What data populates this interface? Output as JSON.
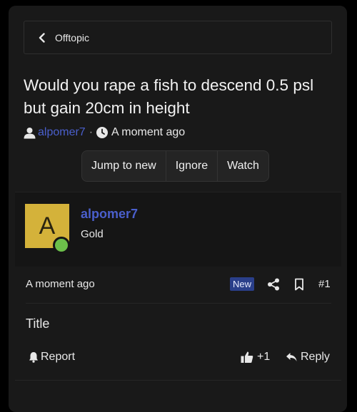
{
  "breadcrumb": {
    "label": "Offtopic",
    "icon": "chevron-left-icon"
  },
  "thread": {
    "title": "Would you rape a fish to descend 0.5 psl but gain 20cm in height",
    "author": "alpomer7",
    "separator": "·",
    "time": "A moment ago"
  },
  "actions": {
    "jump": "Jump to new",
    "ignore": "Ignore",
    "watch": "Watch"
  },
  "post": {
    "avatar_letter": "A",
    "avatar_color": "#d4b23a",
    "online_color": "#6cc04a",
    "username": "alpomer7",
    "rank": "Gold",
    "time": "A moment ago",
    "badge": "New",
    "number": "#1",
    "body": "Title",
    "report_label": "Report",
    "likes_label": "+1",
    "reply_label": "Reply"
  },
  "colors": {
    "link": "#4a5fcc",
    "badge_bg": "#2a3f8a",
    "background": "#191919"
  }
}
